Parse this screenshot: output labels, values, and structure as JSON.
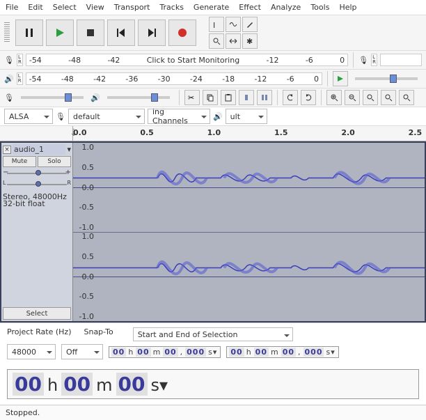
{
  "menu": [
    "File",
    "Edit",
    "Select",
    "View",
    "Transport",
    "Tracks",
    "Generate",
    "Effect",
    "Analyze",
    "Tools",
    "Help"
  ],
  "meter": {
    "ticks": [
      "-54",
      "-48",
      "-42",
      "-36",
      "-30",
      "-24",
      "-18",
      "-12",
      "-6",
      "0"
    ],
    "monitor_msg": "Click to Start Monitoring"
  },
  "host": {
    "api": "ALSA",
    "device": "default",
    "channels": "ing Channels",
    "output": "ult"
  },
  "ruler": [
    "0.0",
    "0.5",
    "1.0",
    "1.5",
    "2.0",
    "2.5"
  ],
  "track": {
    "name": "audio_1",
    "mute": "Mute",
    "solo": "Solo",
    "lr": {
      "l": "L",
      "r": "R"
    },
    "info1": "Stereo, 48000Hz",
    "info2": "32-bit float",
    "select": "Select",
    "y": [
      "1.0",
      "0.5",
      "0.0",
      "-0.5",
      "-1.0"
    ]
  },
  "bottom": {
    "rate_label": "Project Rate (Hz)",
    "snap_label": "Snap-To",
    "sel_label": "Start and End of Selection",
    "rate": "48000",
    "snap": "Off",
    "t1": {
      "h": "00",
      "m": "00",
      "s": "00",
      "ms": "000"
    },
    "t2": {
      "h": "00",
      "m": "00",
      "s": "00",
      "ms": "000"
    }
  },
  "bigtime": {
    "h": "00",
    "m": "00",
    "s": "00"
  },
  "status": "Stopped."
}
